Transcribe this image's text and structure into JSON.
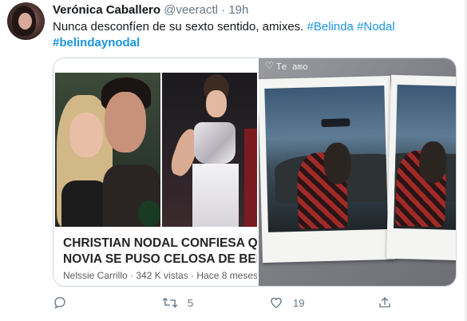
{
  "tweet": {
    "author_name": "Verónica Caballero",
    "author_handle": "@veeractl",
    "separator": "·",
    "time": "19h",
    "text_prefix": "Nunca desconfíen de su sexto sentido, amixes. ",
    "hashtag1": "#Belinda",
    "hashtag2": "#Nodal",
    "hashtag3": "#belindaynodal"
  },
  "media": {
    "article_title_line1": "CHRISTIAN NODAL CONFIESA QUE",
    "article_title_line2": "NOVIA SE PUSO CELOSA DE BELINDA",
    "article_meta": "Nelssie Carrillo · 342 K vistas · Hace 8 meses",
    "story_caption": "Te amo"
  },
  "actions": {
    "reply_count": "",
    "retweet_count": "5",
    "like_count": "19"
  },
  "colors": {
    "link": "#1b95e0",
    "muted": "#657786",
    "border": "#ccd6dd"
  },
  "icons": [
    "reply-icon",
    "retweet-icon",
    "like-icon",
    "share-icon",
    "heart-outline-icon"
  ]
}
